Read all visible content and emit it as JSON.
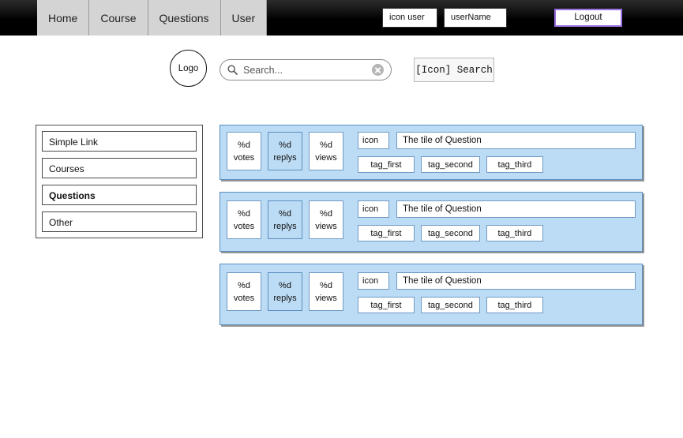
{
  "navbar": {
    "tabs": [
      {
        "label": "Home"
      },
      {
        "label": "Course"
      },
      {
        "label": "Questions"
      },
      {
        "label": "User"
      }
    ],
    "user_icon_label": "icon user",
    "user_name": "userName",
    "logout_label": "Logout",
    "logout_border_color": "#9b6fe0",
    "background_color": "#000000",
    "tab_background_color": "#d4d4d4"
  },
  "header": {
    "logo_label": "Logo",
    "search": {
      "placeholder": "Search...",
      "value": "",
      "icon": "search-icon",
      "clear_icon": "clear-circle-icon"
    },
    "search_button_label": "[Icon] Search"
  },
  "sidebar": {
    "items": [
      {
        "label": "Simple Link",
        "active": false
      },
      {
        "label": "Courses",
        "active": false
      },
      {
        "label": "Questions",
        "active": true
      },
      {
        "label": "Other",
        "active": false
      }
    ]
  },
  "question_list": {
    "card_background_color": "#bcdcf5",
    "card_border_color": "#5a8fc0",
    "cards": [
      {
        "votes_num": "%d",
        "votes_label": "votes",
        "replys_num": "%d",
        "replys_label": "replys",
        "views_num": "%d",
        "views_label": "views",
        "icon_label": "icon",
        "title": "The tile of Question",
        "tags": [
          "tag_first",
          "tag_second",
          "tag_third"
        ]
      },
      {
        "votes_num": "%d",
        "votes_label": "votes",
        "replys_num": "%d",
        "replys_label": "replys",
        "views_num": "%d",
        "views_label": "views",
        "icon_label": "icon",
        "title": "The tile of Question",
        "tags": [
          "tag_first",
          "tag_second",
          "tag_third"
        ]
      },
      {
        "votes_num": "%d",
        "votes_label": "votes",
        "replys_num": "%d",
        "replys_label": "replys",
        "views_num": "%d",
        "views_label": "views",
        "icon_label": "icon",
        "title": "The tile of Question",
        "tags": [
          "tag_first",
          "tag_second",
          "tag_third"
        ]
      }
    ]
  }
}
